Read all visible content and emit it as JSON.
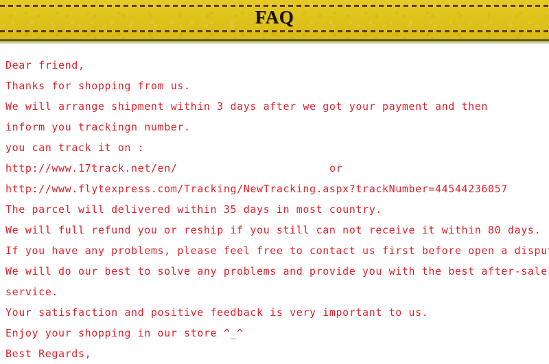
{
  "banner": {
    "title": "FAQ",
    "background_color": "#e2c51e",
    "stitch_color": "#5e3a08",
    "title_color": "#14100a"
  },
  "letter": {
    "text_color": "#e3202b",
    "lines": [
      {
        "text": "Dear friend,"
      },
      {
        "text": "Thanks for shopping from us."
      },
      {
        "text": "We will arrange shipment within 3 days after we got your payment and then"
      },
      {
        "text": "inform you trackingn number."
      },
      {
        "text": "you can track it on :"
      },
      {
        "text": "http://www.17track.net/en/",
        "suffix": "or"
      },
      {
        "text": "http://www.flytexpress.com/Tracking/NewTracking.aspx?trackNumber=44544236057"
      },
      {
        "text": "The parcel will delivered within 35 days in most country."
      },
      {
        "text": "We will full refund you or reship if you still can not receive it within 80 days."
      },
      {
        "text": "If you have any problems, please feel free to contact us first before open a dispute."
      },
      {
        "text": "We will do our best to solve any problems and provide you with the best after-sale"
      },
      {
        "text": "service."
      },
      {
        "text": "Your satisfaction and positive feedback is very important to us."
      },
      {
        "text": "Enjoy your shopping in our store ^_^"
      },
      {
        "text": "Best Regards,"
      }
    ]
  }
}
